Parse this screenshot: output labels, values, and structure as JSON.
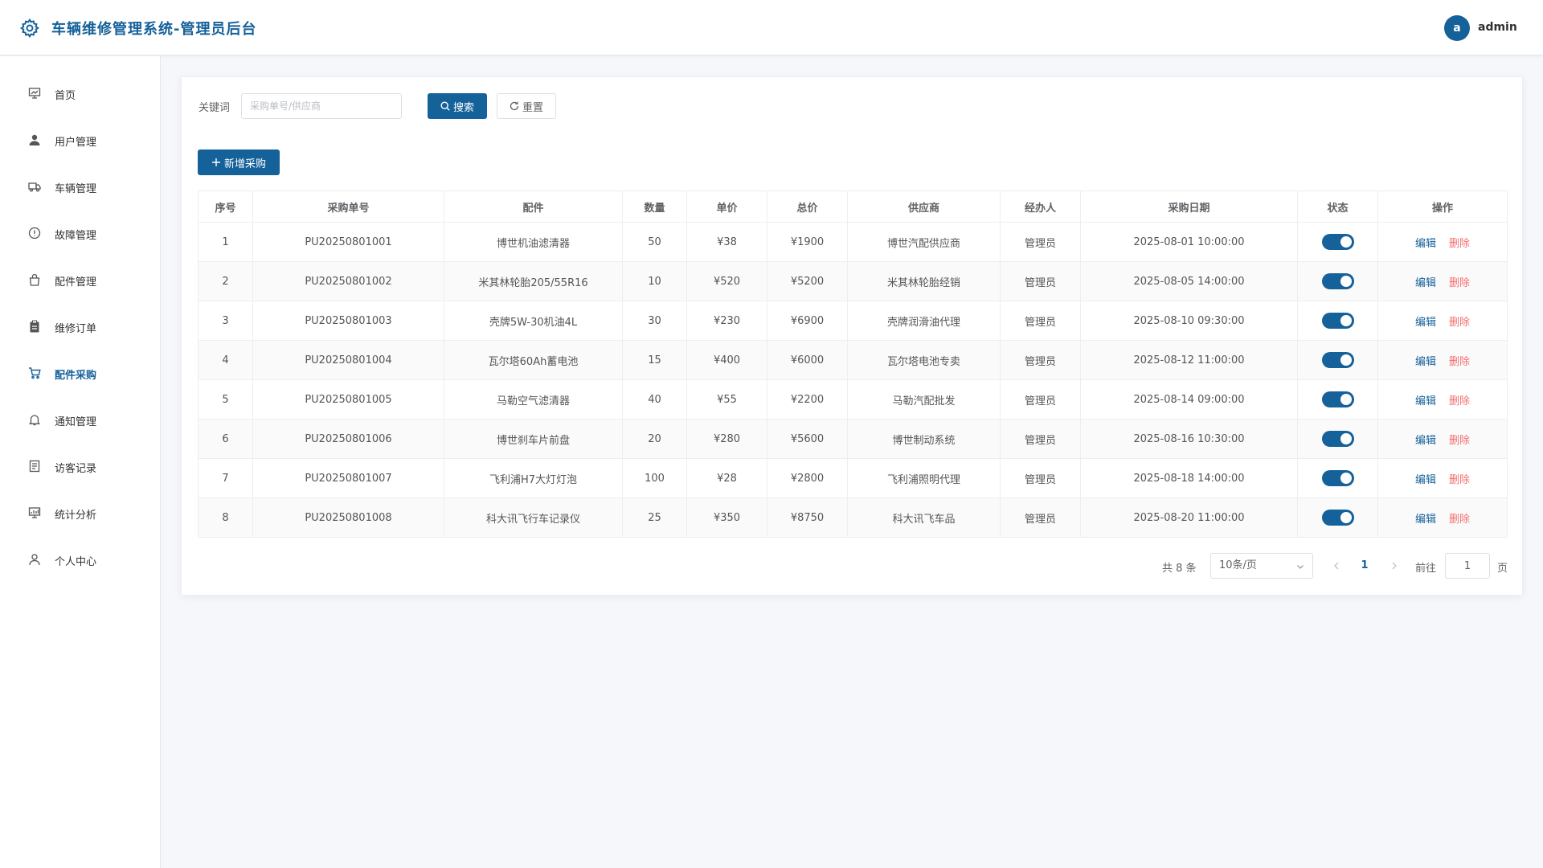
{
  "header": {
    "title": "车辆维修管理系统-管理员后台",
    "avatar_letter": "a",
    "username": "admin"
  },
  "sidebar": {
    "items": [
      {
        "label": "首页",
        "icon": "monitor-icon",
        "active": false
      },
      {
        "label": "用户管理",
        "icon": "user-icon",
        "active": false
      },
      {
        "label": "车辆管理",
        "icon": "truck-icon",
        "active": false
      },
      {
        "label": "故障管理",
        "icon": "warning-icon",
        "active": false
      },
      {
        "label": "配件管理",
        "icon": "bag-icon",
        "active": false
      },
      {
        "label": "维修订单",
        "icon": "clipboard-icon",
        "active": false
      },
      {
        "label": "配件采购",
        "icon": "cart-icon",
        "active": true
      },
      {
        "label": "通知管理",
        "icon": "bell-icon",
        "active": false
      },
      {
        "label": "访客记录",
        "icon": "document-icon",
        "active": false
      },
      {
        "label": "统计分析",
        "icon": "chart-monitor-icon",
        "active": false
      },
      {
        "label": "个人中心",
        "icon": "person-icon",
        "active": false
      }
    ]
  },
  "search": {
    "label": "关键词",
    "placeholder": "采购单号/供应商",
    "value": "",
    "search_label": "搜索",
    "reset_label": "重置"
  },
  "add_label": "新增采购",
  "table": {
    "columns": [
      "序号",
      "采购单号",
      "配件",
      "数量",
      "单价",
      "总价",
      "供应商",
      "经办人",
      "采购日期",
      "状态",
      "操作"
    ],
    "edit_label": "编辑",
    "delete_label": "删除",
    "rows": [
      {
        "idx": "1",
        "order_no": "PU20250801001",
        "part": "博世机油滤清器",
        "qty": "50",
        "unit_price": "¥38",
        "total": "¥1900",
        "supplier": "博世汽配供应商",
        "handler": "管理员",
        "date": "2025-08-01 10:00:00",
        "status_on": true
      },
      {
        "idx": "2",
        "order_no": "PU20250801002",
        "part": "米其林轮胎205/55R16",
        "qty": "10",
        "unit_price": "¥520",
        "total": "¥5200",
        "supplier": "米其林轮胎经销",
        "handler": "管理员",
        "date": "2025-08-05 14:00:00",
        "status_on": true
      },
      {
        "idx": "3",
        "order_no": "PU20250801003",
        "part": "壳牌5W-30机油4L",
        "qty": "30",
        "unit_price": "¥230",
        "total": "¥6900",
        "supplier": "壳牌润滑油代理",
        "handler": "管理员",
        "date": "2025-08-10 09:30:00",
        "status_on": true
      },
      {
        "idx": "4",
        "order_no": "PU20250801004",
        "part": "瓦尔塔60Ah蓄电池",
        "qty": "15",
        "unit_price": "¥400",
        "total": "¥6000",
        "supplier": "瓦尔塔电池专卖",
        "handler": "管理员",
        "date": "2025-08-12 11:00:00",
        "status_on": true
      },
      {
        "idx": "5",
        "order_no": "PU20250801005",
        "part": "马勒空气滤清器",
        "qty": "40",
        "unit_price": "¥55",
        "total": "¥2200",
        "supplier": "马勒汽配批发",
        "handler": "管理员",
        "date": "2025-08-14 09:00:00",
        "status_on": true
      },
      {
        "idx": "6",
        "order_no": "PU20250801006",
        "part": "博世刹车片前盘",
        "qty": "20",
        "unit_price": "¥280",
        "total": "¥5600",
        "supplier": "博世制动系统",
        "handler": "管理员",
        "date": "2025-08-16 10:30:00",
        "status_on": true
      },
      {
        "idx": "7",
        "order_no": "PU20250801007",
        "part": "飞利浦H7大灯灯泡",
        "qty": "100",
        "unit_price": "¥28",
        "total": "¥2800",
        "supplier": "飞利浦照明代理",
        "handler": "管理员",
        "date": "2025-08-18 14:00:00",
        "status_on": true
      },
      {
        "idx": "8",
        "order_no": "PU20250801008",
        "part": "科大讯飞行车记录仪",
        "qty": "25",
        "unit_price": "¥350",
        "total": "¥8750",
        "supplier": "科大讯飞车品",
        "handler": "管理员",
        "date": "2025-08-20 11:00:00",
        "status_on": true
      }
    ]
  },
  "pagination": {
    "total_text": "共 8 条",
    "page_size": "10条/页",
    "current_page": "1",
    "goto_label": "前往",
    "goto_value": "1",
    "page_unit": "页"
  },
  "colors": {
    "primary": "#15619a",
    "danger": "#f56c6c"
  }
}
